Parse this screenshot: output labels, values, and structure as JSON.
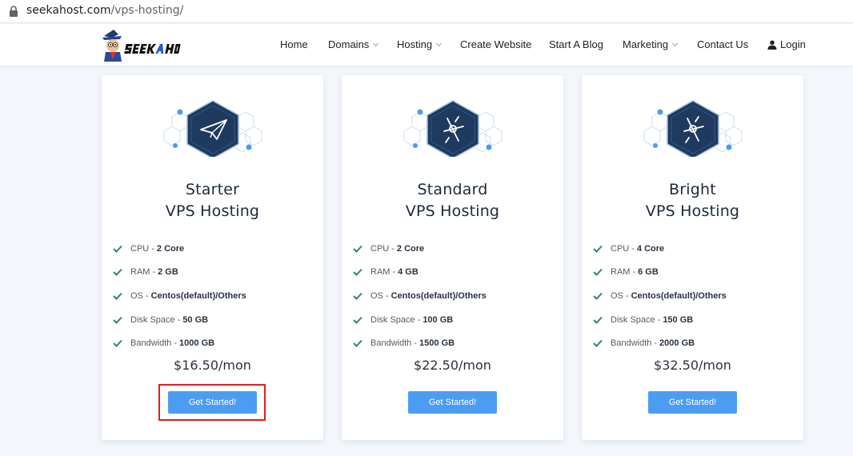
{
  "browser": {
    "url_domain": "seekahost.com",
    "url_path": "/vps-hosting/"
  },
  "nav": {
    "items": [
      {
        "label": "Home",
        "dropdown": false
      },
      {
        "label": "Domains",
        "dropdown": true
      },
      {
        "label": "Hosting",
        "dropdown": true
      },
      {
        "label": "Create Website",
        "dropdown": false
      },
      {
        "label": "Start A Blog",
        "dropdown": false
      },
      {
        "label": "Marketing",
        "dropdown": true
      },
      {
        "label": "Contact Us",
        "dropdown": false
      }
    ],
    "login": "Login"
  },
  "plans": [
    {
      "title_line1": "Starter",
      "title_line2": "VPS Hosting",
      "icon": "paper-plane-icon",
      "features": [
        {
          "label": "CPU",
          "value": "2 Core"
        },
        {
          "label": "RAM",
          "value": "2 GB"
        },
        {
          "label": "OS",
          "value": "Centos(default)/Others"
        },
        {
          "label": "Disk Space",
          "value": "50 GB"
        },
        {
          "label": "Bandwidth",
          "value": "1000 GB"
        }
      ],
      "price": "$16.50/mon",
      "button": "Get Started!",
      "highlighted": true
    },
    {
      "title_line1": "Standard",
      "title_line2": "VPS Hosting",
      "icon": "satellite-icon",
      "features": [
        {
          "label": "CPU",
          "value": "2 Core"
        },
        {
          "label": "RAM",
          "value": "4 GB"
        },
        {
          "label": "OS",
          "value": "Centos(default)/Others"
        },
        {
          "label": "Disk Space",
          "value": "100 GB"
        },
        {
          "label": "Bandwidth",
          "value": "1500 GB"
        }
      ],
      "price": "$22.50/mon",
      "button": "Get Started!",
      "highlighted": false
    },
    {
      "title_line1": "Bright",
      "title_line2": "VPS Hosting",
      "icon": "satellite-icon",
      "features": [
        {
          "label": "CPU",
          "value": "4 Core"
        },
        {
          "label": "RAM",
          "value": "6 GB"
        },
        {
          "label": "OS",
          "value": "Centos(default)/Others"
        },
        {
          "label": "Disk Space",
          "value": "150 GB"
        },
        {
          "label": "Bandwidth",
          "value": "2000 GB"
        }
      ],
      "price": "$32.50/mon",
      "button": "Get Started!",
      "highlighted": false
    }
  ],
  "colors": {
    "accent": "#4c9df2",
    "check": "#2e8b57",
    "hex_dark": "#1f3a5f",
    "highlight": "#e01e1e"
  }
}
